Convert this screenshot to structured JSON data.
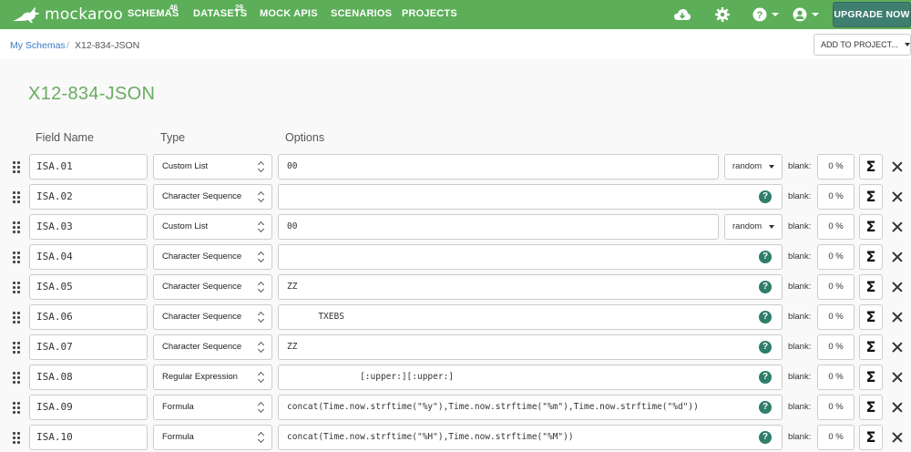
{
  "app": {
    "logo_text": "mockaroo"
  },
  "nav": {
    "items": [
      {
        "label": "SCHEMAS",
        "badge": "46"
      },
      {
        "label": "DATASETS",
        "badge": "29"
      },
      {
        "label": "MOCK APIS"
      },
      {
        "label": "SCENARIOS"
      },
      {
        "label": "PROJECTS"
      }
    ],
    "upgrade_label": "UPGRADE NOW"
  },
  "breadcrumb": {
    "root": "My Schemas",
    "separator": "/",
    "current": "X12-834-JSON"
  },
  "add_to_project_label": "ADD TO PROJECT...",
  "page_title": "X12-834-JSON",
  "columns": {
    "field_name": "Field Name",
    "type": "Type",
    "options": "Options"
  },
  "blank_label": "blank:",
  "colors": {
    "brand": "#5cae59",
    "upgrade": "#3f7f6f",
    "title": "#6aab62",
    "link": "#3a7bc8",
    "help": "#2f7d6b"
  },
  "rows": [
    {
      "name": "ISA.01",
      "type": "Custom List",
      "options": "00",
      "mode": "random",
      "blank": "0 %"
    },
    {
      "name": "ISA.02",
      "type": "Character Sequence",
      "options": "",
      "blank": "0 %"
    },
    {
      "name": "ISA.03",
      "type": "Custom List",
      "options": "00",
      "mode": "random",
      "blank": "0 %"
    },
    {
      "name": "ISA.04",
      "type": "Character Sequence",
      "options": "",
      "blank": "0 %"
    },
    {
      "name": "ISA.05",
      "type": "Character Sequence",
      "options": "ZZ",
      "blank": "0 %"
    },
    {
      "name": "ISA.06",
      "type": "Character Sequence",
      "options": "      TXEBS",
      "blank": "0 %"
    },
    {
      "name": "ISA.07",
      "type": "Character Sequence",
      "options": "ZZ",
      "blank": "0 %"
    },
    {
      "name": "ISA.08",
      "type": "Regular Expression",
      "options": "              [:upper:][:upper:]",
      "blank": "0 %"
    },
    {
      "name": "ISA.09",
      "type": "Formula",
      "options": "concat(Time.now.strftime(\"%y\"),Time.now.strftime(\"%m\"),Time.now.strftime(\"%d\"))",
      "blank": "0 %"
    },
    {
      "name": "ISA.10",
      "type": "Formula",
      "options": "concat(Time.now.strftime(\"%H\"),Time.now.strftime(\"%M\"))",
      "blank": "0 %"
    }
  ]
}
